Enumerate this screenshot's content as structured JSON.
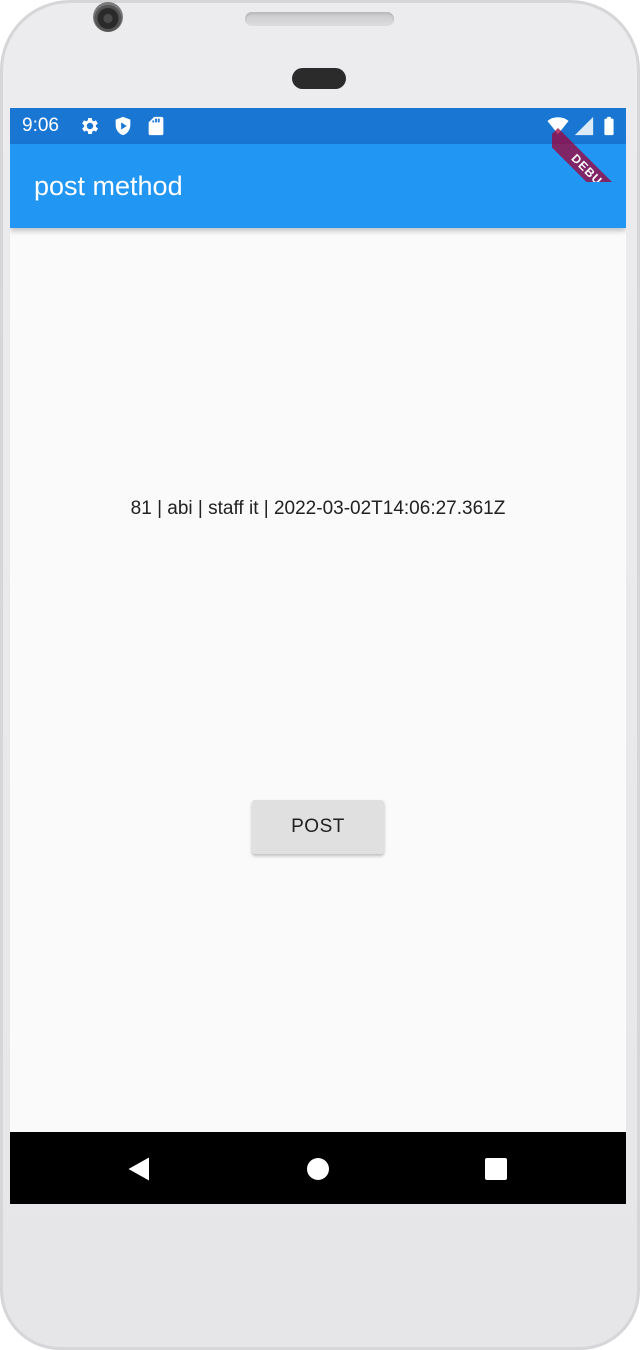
{
  "status_bar": {
    "time": "9:06",
    "icons": [
      "gear-icon",
      "shield-play-icon",
      "sd-card-icon",
      "wifi-icon",
      "signal-icon",
      "battery-icon"
    ]
  },
  "app_bar": {
    "title": "post method",
    "color": "#2196f3",
    "status_color": "#1976d2"
  },
  "debug_banner": {
    "label": "DEBUG"
  },
  "main": {
    "result_text": "81 | abi | staff it | 2022-03-02T14:06:27.361Z",
    "post_button_label": "POST"
  },
  "nav_bar": {
    "buttons": [
      "back-icon",
      "home-icon",
      "recents-icon"
    ]
  }
}
